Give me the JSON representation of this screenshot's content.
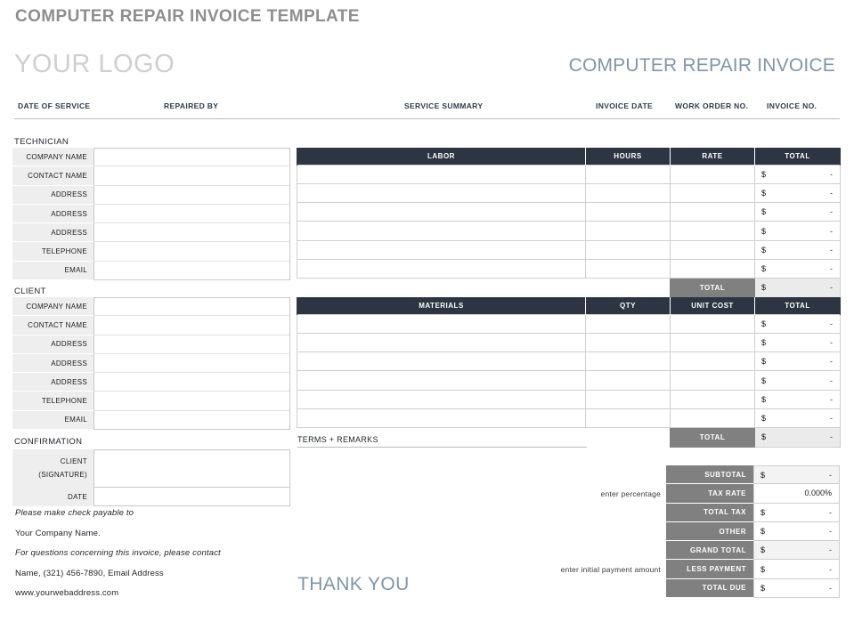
{
  "document": {
    "title": "COMPUTER REPAIR INVOICE TEMPLATE",
    "logo": "YOUR LOGO",
    "invoice_title": "COMPUTER REPAIR INVOICE",
    "thank_you": "THANK YOU"
  },
  "service_header": {
    "date_of_service": "DATE OF SERVICE",
    "repaired_by": "REPAIRED BY",
    "service_summary": "SERVICE SUMMARY",
    "invoice_date": "INVOICE DATE",
    "work_order_no": "WORK ORDER NO.",
    "invoice_no": "INVOICE NO."
  },
  "technician": {
    "section_label": "TECHNICIAN",
    "fields": [
      {
        "label": "COMPANY NAME",
        "value": ""
      },
      {
        "label": "CONTACT NAME",
        "value": ""
      },
      {
        "label": "ADDRESS",
        "value": ""
      },
      {
        "label": "ADDRESS",
        "value": ""
      },
      {
        "label": "ADDRESS",
        "value": ""
      },
      {
        "label": "TELEPHONE",
        "value": ""
      },
      {
        "label": "EMAIL",
        "value": ""
      }
    ]
  },
  "client": {
    "section_label": "CLIENT",
    "fields": [
      {
        "label": "COMPANY NAME",
        "value": ""
      },
      {
        "label": "CONTACT NAME",
        "value": ""
      },
      {
        "label": "ADDRESS",
        "value": ""
      },
      {
        "label": "ADDRESS",
        "value": ""
      },
      {
        "label": "ADDRESS",
        "value": ""
      },
      {
        "label": "TELEPHONE",
        "value": ""
      },
      {
        "label": "EMAIL",
        "value": ""
      }
    ]
  },
  "confirmation": {
    "section_label": "CONFIRMATION",
    "client_label": "CLIENT",
    "signature_label": "(SIGNATURE)",
    "date_label": "DATE",
    "client_value": "",
    "date_value": ""
  },
  "labor_table": {
    "columns": [
      "LABOR",
      "HOURS",
      "RATE",
      "TOTAL"
    ],
    "rows": [
      {
        "labor": "",
        "hours": "",
        "rate": "",
        "currency": "$",
        "total": "-"
      },
      {
        "labor": "",
        "hours": "",
        "rate": "",
        "currency": "$",
        "total": "-"
      },
      {
        "labor": "",
        "hours": "",
        "rate": "",
        "currency": "$",
        "total": "-"
      },
      {
        "labor": "",
        "hours": "",
        "rate": "",
        "currency": "$",
        "total": "-"
      },
      {
        "labor": "",
        "hours": "",
        "rate": "",
        "currency": "$",
        "total": "-"
      },
      {
        "labor": "",
        "hours": "",
        "rate": "",
        "currency": "$",
        "total": "-"
      }
    ],
    "total_label": "TOTAL",
    "total_currency": "$",
    "total_value": "-"
  },
  "materials_table": {
    "columns": [
      "MATERIALS",
      "QTY",
      "UNIT COST",
      "TOTAL"
    ],
    "rows": [
      {
        "materials": "",
        "qty": "",
        "unit_cost": "",
        "currency": "$",
        "total": "-"
      },
      {
        "materials": "",
        "qty": "",
        "unit_cost": "",
        "currency": "$",
        "total": "-"
      },
      {
        "materials": "",
        "qty": "",
        "unit_cost": "",
        "currency": "$",
        "total": "-"
      },
      {
        "materials": "",
        "qty": "",
        "unit_cost": "",
        "currency": "$",
        "total": "-"
      },
      {
        "materials": "",
        "qty": "",
        "unit_cost": "",
        "currency": "$",
        "total": "-"
      },
      {
        "materials": "",
        "qty": "",
        "unit_cost": "",
        "currency": "$",
        "total": "-"
      }
    ],
    "total_label": "TOTAL",
    "total_currency": "$",
    "total_value": "-"
  },
  "terms": {
    "label": "TERMS + REMARKS",
    "value": ""
  },
  "summary": {
    "hint_tax_rate": "enter percentage",
    "hint_less_payment": "enter initial payment amount",
    "rows": [
      {
        "label": "SUBTOTAL",
        "currency": "$",
        "value": "-",
        "shaded": true
      },
      {
        "label": "TAX RATE",
        "currency": "",
        "value": "0.000%",
        "shaded": false
      },
      {
        "label": "TOTAL TAX",
        "currency": "$",
        "value": "-",
        "shaded": false
      },
      {
        "label": "OTHER",
        "currency": "$",
        "value": "-",
        "shaded": false
      },
      {
        "label": "GRAND TOTAL",
        "currency": "$",
        "value": "-",
        "shaded": true
      },
      {
        "label": "LESS PAYMENT",
        "currency": "$",
        "value": "-",
        "shaded": false
      },
      {
        "label": "TOTAL DUE",
        "currency": "$",
        "value": "-",
        "shaded": false
      }
    ]
  },
  "footer": {
    "line1": "Please make check payable to",
    "line2": "Your Company Name.",
    "line3": "For questions concerning this invoice, please contact",
    "line4": "Name, (321) 456-7890, Email Address",
    "line5": "www.yourwebaddress.com"
  },
  "colors": {
    "header_navy": "#2d3442",
    "total_gray": "#808080",
    "label_gray": "#eeeeee",
    "accent_blue": "#8195a8",
    "title_gray": "#8e8e8e",
    "logo_gray": "#cfcfcf"
  }
}
